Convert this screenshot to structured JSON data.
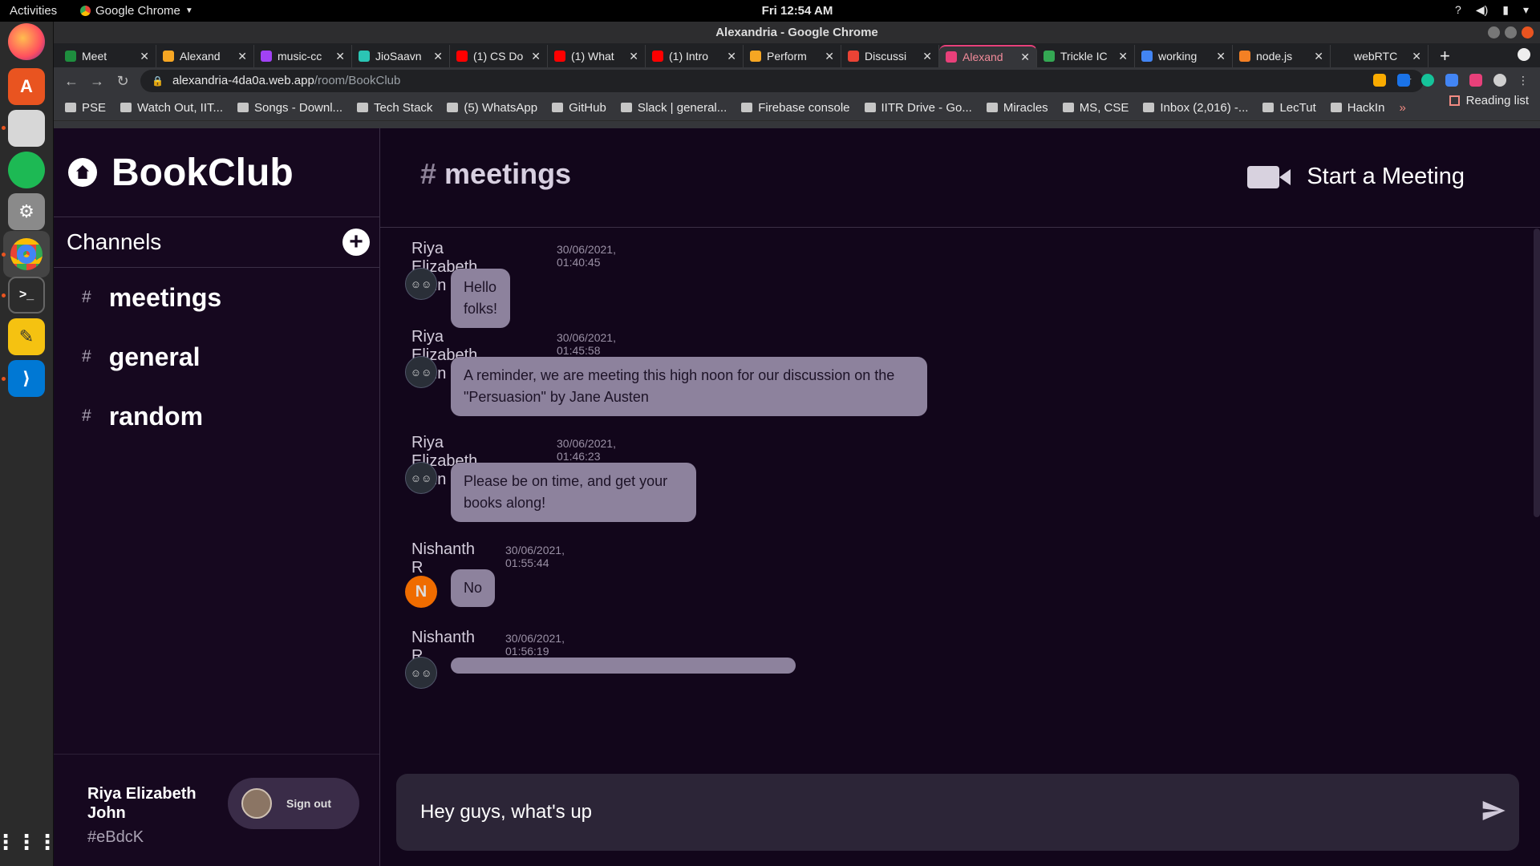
{
  "os": {
    "activities": "Activities",
    "app_menu": "Google Chrome",
    "clock": "Fri 12:54 AM"
  },
  "browser": {
    "window_title": "Alexandria - Google Chrome",
    "tabs": [
      {
        "label": "Meet",
        "color": "#1e8e3e"
      },
      {
        "label": "Alexand",
        "color": "#f6a623"
      },
      {
        "label": "music-cc",
        "color": "#a142f4"
      },
      {
        "label": "JioSaavn",
        "color": "#2bc5b4"
      },
      {
        "label": "(1) CS Do",
        "color": "#ff0000"
      },
      {
        "label": "(1) What",
        "color": "#ff0000"
      },
      {
        "label": "(1) Intro",
        "color": "#ff0000"
      },
      {
        "label": "Perform",
        "color": "#f6a623"
      },
      {
        "label": "Discussi",
        "color": "#ea4335"
      },
      {
        "label": "Alexand",
        "color": "#e8407a",
        "active": true
      },
      {
        "label": "Trickle IC",
        "color": "#34a853"
      },
      {
        "label": "working",
        "color": "#4285f4"
      },
      {
        "label": "node.js",
        "color": "#f48024"
      },
      {
        "label": "webRTC",
        "color": "#202124"
      }
    ],
    "url_host": "alexandria-4da0a.web.app",
    "url_path": "/room/BookClub",
    "bookmarks": [
      "PSE",
      "Watch Out, IIT...",
      "Songs - Downl...",
      "Tech Stack",
      "(5) WhatsApp",
      "GitHub",
      "Slack | general...",
      "Firebase console",
      "IITR Drive - Go...",
      "Miracles",
      "MS, CSE",
      "Inbox (2,016) -...",
      "LecTut",
      "HackIn"
    ],
    "overflow": "»",
    "reading_list": "Reading list"
  },
  "app": {
    "brand": "BookClub",
    "channels_title": "Channels",
    "channels": [
      {
        "hash": "#",
        "name": "meetings"
      },
      {
        "hash": "#",
        "name": "general"
      },
      {
        "hash": "#",
        "name": "random"
      }
    ],
    "user": {
      "name": "Riya Elizabeth John",
      "tag": "#eBdcK",
      "signout_label": "Sign out"
    },
    "current_channel": {
      "hash": "#",
      "name": "meetings"
    },
    "start_meeting_label": "Start a Meeting",
    "messages": [
      {
        "author": "Riya Elizabeth John",
        "time": "30/06/2021, 01:40:45",
        "text": "Hello folks!"
      },
      {
        "author": "Riya Elizabeth John",
        "time": "30/06/2021, 01:45:58",
        "text": "A reminder, we are meeting this high noon for our discussion on the \"Persuasion\" by Jane Austen"
      },
      {
        "author": "Riya Elizabeth John",
        "time": "30/06/2021, 01:46:23",
        "text": "Please be on time, and get your books along!"
      },
      {
        "author": "Nishanth R",
        "time": "30/06/2021, 01:55:44",
        "text": "No",
        "initial": "N"
      },
      {
        "author": "Nishanth R",
        "time": "30/06/2021, 01:56:19",
        "text": ""
      }
    ],
    "composer_value": "Hey guys, what's up"
  }
}
